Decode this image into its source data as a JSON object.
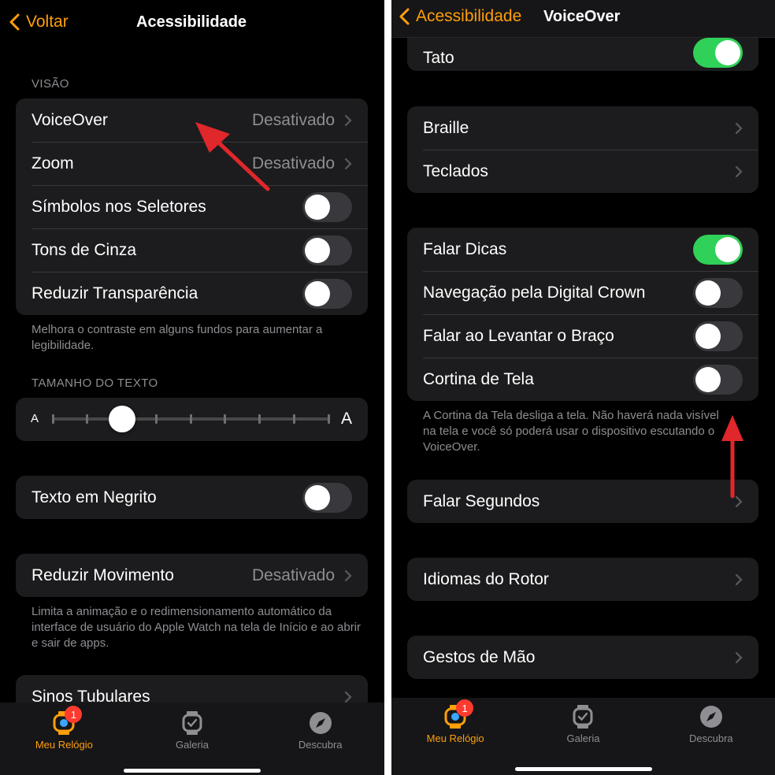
{
  "left": {
    "nav": {
      "back_label": "Voltar",
      "title": "Acessibilidade"
    },
    "section_vision": "VISÃO",
    "vision_rows": [
      {
        "label": "VoiceOver",
        "value": "Desativado"
      },
      {
        "label": "Zoom",
        "value": "Desativado"
      },
      {
        "label": "Símbolos nos Seletores",
        "toggle": false
      },
      {
        "label": "Tons de Cinza",
        "toggle": false
      },
      {
        "label": "Reduzir Transparência",
        "toggle": false
      }
    ],
    "vision_footnote": "Melhora o contraste em alguns fundos para aumentar a legibilidade.",
    "section_text_size": "TAMANHO DO TEXTO",
    "text_size_slider": {
      "small_label": "A",
      "large_label": "A",
      "level": 3,
      "steps": 9
    },
    "bold_row": {
      "label": "Texto em Negrito",
      "toggle": false
    },
    "motion_row": {
      "label": "Reduzir Movimento",
      "value": "Desativado"
    },
    "motion_footnote": "Limita a animação e o redimensionamento automático da interface de usuário do Apple Watch na tela de Início e ao abrir e sair de apps.",
    "chimes_row": {
      "label": "Sinos Tubulares"
    }
  },
  "right": {
    "nav": {
      "back_label": "Acessibilidade",
      "title": "VoiceOver"
    },
    "tato_row": {
      "label": "Tato",
      "toggle": true
    },
    "braille_rows": [
      {
        "label": "Braille"
      },
      {
        "label": "Teclados"
      }
    ],
    "speech_rows": [
      {
        "label": "Falar Dicas",
        "toggle": true
      },
      {
        "label": "Navegação pela Digital Crown",
        "toggle": false
      },
      {
        "label": "Falar ao Levantar o Braço",
        "toggle": false
      },
      {
        "label": "Cortina de Tela",
        "toggle": false
      }
    ],
    "curtain_footnote": "A Cortina da Tela desliga a tela. Não haverá nada visível na tela e você só poderá usar o dispositivo escutando o VoiceOver.",
    "seconds_row": {
      "label": "Falar Segundos"
    },
    "rotor_row": {
      "label": "Idiomas do Rotor"
    },
    "gestures_row": {
      "label": "Gestos de Mão"
    }
  },
  "tabbar": {
    "tabs": [
      {
        "label": "Meu Relógio",
        "icon": "watch-face-icon",
        "badge": "1",
        "active": true
      },
      {
        "label": "Galeria",
        "icon": "watch-icon"
      },
      {
        "label": "Descubra",
        "icon": "compass-icon"
      }
    ]
  },
  "colors": {
    "accent": "#ff9f0a",
    "toggle_on": "#30d158",
    "cell_background": "#1c1c1e",
    "annotation_arrow": "#e0272b"
  }
}
